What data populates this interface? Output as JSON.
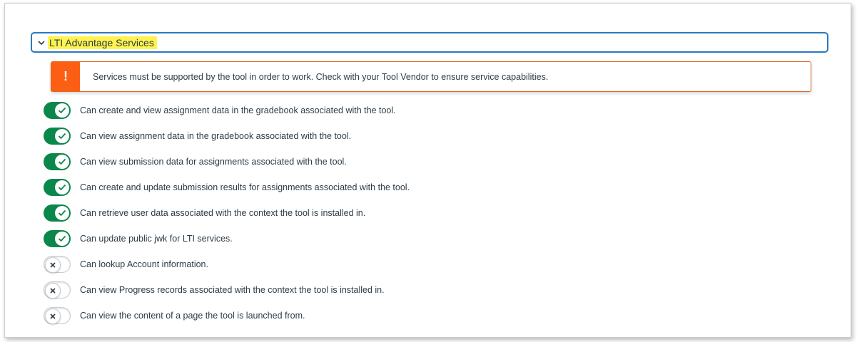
{
  "section": {
    "title": "LTI Advantage Services",
    "expanded": true,
    "icon": "chevron-down-icon"
  },
  "alert": {
    "icon": "exclamation-icon",
    "text": "Services must be supported by the tool in order to work. Check with your Tool Vendor to ensure service capabilities.",
    "color": "#fc5e13"
  },
  "colors": {
    "toggle_on": "#0b874b",
    "focus_border": "#2b7abc",
    "highlight": "#fff44f"
  },
  "services": [
    {
      "label": "Can create and view assignment data in the gradebook associated with the tool.",
      "enabled": true
    },
    {
      "label": "Can view assignment data in the gradebook associated with the tool.",
      "enabled": true
    },
    {
      "label": "Can view submission data for assignments associated with the tool.",
      "enabled": true
    },
    {
      "label": "Can create and update submission results for assignments associated with the tool.",
      "enabled": true
    },
    {
      "label": "Can retrieve user data associated with the context the tool is installed in.",
      "enabled": true
    },
    {
      "label": "Can update public jwk for LTI services.",
      "enabled": true
    },
    {
      "label": "Can lookup Account information.",
      "enabled": false
    },
    {
      "label": "Can view Progress records associated with the context the tool is installed in.",
      "enabled": false
    },
    {
      "label": "Can view the content of a page the tool is launched from.",
      "enabled": false
    }
  ]
}
